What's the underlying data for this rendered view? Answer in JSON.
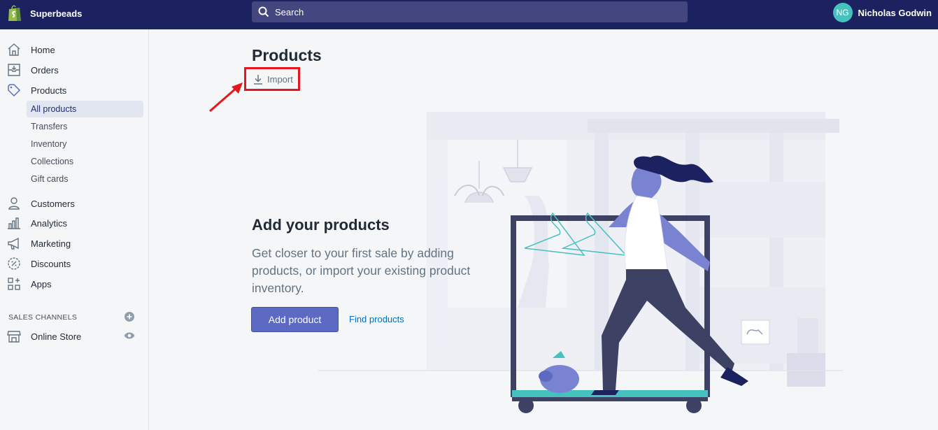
{
  "topbar": {
    "store_name": "Superbeads",
    "search_placeholder": "Search",
    "user_initials": "NG",
    "user_name": "Nicholas Godwin"
  },
  "sidebar": {
    "items": [
      {
        "label": "Home",
        "icon": "home-icon"
      },
      {
        "label": "Orders",
        "icon": "orders-icon"
      },
      {
        "label": "Products",
        "icon": "tag-icon"
      },
      {
        "label": "Customers",
        "icon": "person-icon"
      },
      {
        "label": "Analytics",
        "icon": "bar-chart-icon"
      },
      {
        "label": "Marketing",
        "icon": "megaphone-icon"
      },
      {
        "label": "Discounts",
        "icon": "discount-icon"
      },
      {
        "label": "Apps",
        "icon": "apps-icon"
      }
    ],
    "product_subitems": [
      "All products",
      "Transfers",
      "Inventory",
      "Collections",
      "Gift cards"
    ],
    "active_subitem": "All products",
    "sales_channels_title": "SALES CHANNELS",
    "online_store_label": "Online Store"
  },
  "main": {
    "title": "Products",
    "import_label": "Import",
    "empty_state": {
      "heading": "Add your products",
      "text": "Get closer to your first sale by adding products, or import your existing product inventory.",
      "primary_action": "Add product",
      "secondary_action": "Find products"
    }
  },
  "colors": {
    "topbar": "#1c2260",
    "primary": "#5c6ac4",
    "highlight_box": "#e5161d",
    "link": "#006fbb"
  }
}
